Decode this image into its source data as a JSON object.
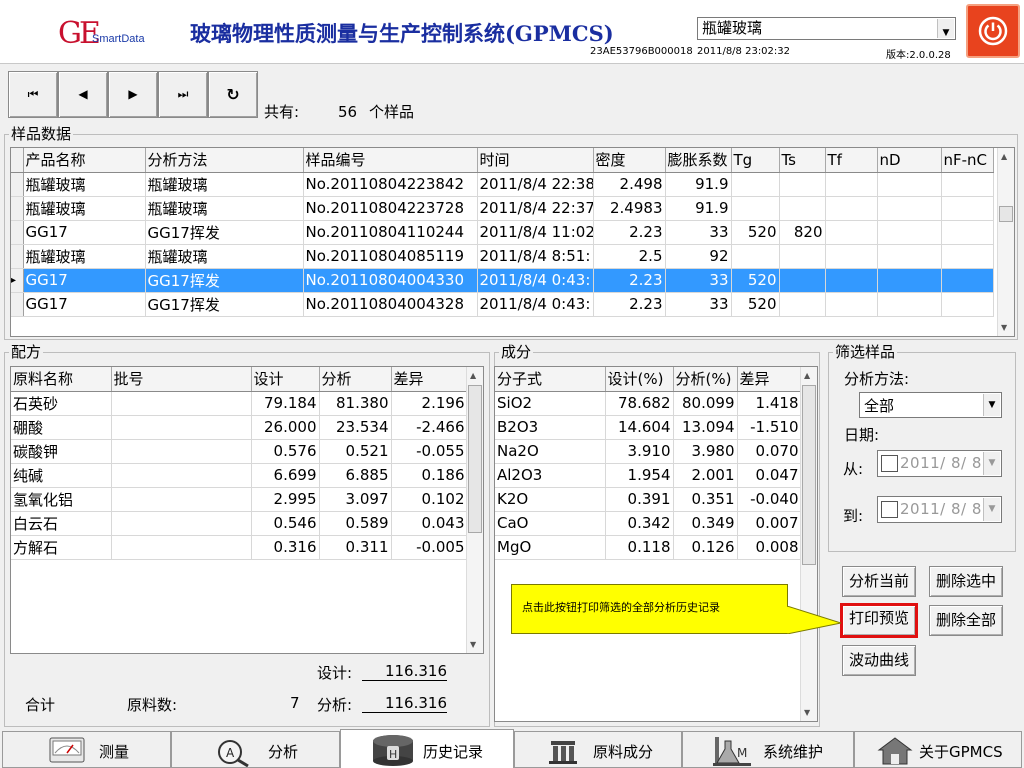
{
  "header": {
    "logo_main": "GE",
    "logo_sub": "SmartData",
    "title": "玻璃物理性质测量与生产控制系统(GPMCS)",
    "serial": "23AE53796B000018",
    "product_select": "瓶罐玻璃",
    "datetime": "2011/8/8 23:02:32",
    "version": "版本:2.0.0.28"
  },
  "nav": {
    "first": "⏮",
    "prev": "◀",
    "next": "▶",
    "last": "⏭",
    "refresh": "↻",
    "count_label": "共有:",
    "count_value": "56",
    "count_unit": "个样品"
  },
  "samples": {
    "title": "样品数据",
    "columns": [
      "产品名称",
      "分析方法",
      "样品编号",
      "时间",
      "密度",
      "膨胀系数",
      "Tg",
      "Ts",
      "Tf",
      "nD",
      "nF-nC"
    ],
    "rows": [
      [
        "瓶罐玻璃",
        "瓶罐玻璃",
        "No.20110804223842",
        "2011/8/4 22:38",
        "2.498",
        "91.9",
        "",
        "",
        "",
        "",
        ""
      ],
      [
        "瓶罐玻璃",
        "瓶罐玻璃",
        "No.20110804223728",
        "2011/8/4 22:37",
        "2.4983",
        "91.9",
        "",
        "",
        "",
        "",
        ""
      ],
      [
        "GG17",
        "GG17挥发",
        "No.20110804110244",
        "2011/8/4 11:02",
        "2.23",
        "33",
        "520",
        "820",
        "",
        "",
        ""
      ],
      [
        "瓶罐玻璃",
        "瓶罐玻璃",
        "No.20110804085119",
        "2011/8/4 8:51:",
        "2.5",
        "92",
        "",
        "",
        "",
        "",
        ""
      ],
      [
        "GG17",
        "GG17挥发",
        "No.20110804004330",
        "2011/8/4 0:43:",
        "2.23",
        "33",
        "520",
        "",
        "",
        "",
        ""
      ],
      [
        "GG17",
        "GG17挥发",
        "No.20110804004328",
        "2011/8/4 0:43:",
        "2.23",
        "33",
        "520",
        "",
        "",
        "",
        ""
      ]
    ],
    "selected_row": 4
  },
  "recipe": {
    "title": "配方",
    "columns": [
      "原料名称",
      "批号",
      "设计",
      "分析",
      "差异"
    ],
    "rows": [
      [
        "石英砂",
        "",
        "79.184",
        "81.380",
        "2.196"
      ],
      [
        "硼酸",
        "",
        "26.000",
        "23.534",
        "-2.466"
      ],
      [
        "碳酸钾",
        "",
        "0.576",
        "0.521",
        "-0.055"
      ],
      [
        "纯碱",
        "",
        "6.699",
        "6.885",
        "0.186"
      ],
      [
        "氢氧化铝",
        "",
        "2.995",
        "3.097",
        "0.102"
      ],
      [
        "白云石",
        "",
        "0.546",
        "0.589",
        "0.043"
      ],
      [
        "方解石",
        "",
        "0.316",
        "0.311",
        "-0.005"
      ]
    ],
    "design_label": "设计:",
    "design_value": "116.316",
    "total_label": "合计",
    "material_count_label": "原料数:",
    "material_count": "7",
    "analysis_label": "分析:",
    "analysis_value": "116.316"
  },
  "composition": {
    "title": "成分",
    "columns": [
      "分子式",
      "设计(%)",
      "分析(%)",
      "差异"
    ],
    "rows": [
      [
        "SiO2",
        "78.682",
        "80.099",
        "1.418"
      ],
      [
        "B2O3",
        "14.604",
        "13.094",
        "-1.510"
      ],
      [
        "Na2O",
        "3.910",
        "3.980",
        "0.070"
      ],
      [
        "Al2O3",
        "1.954",
        "2.001",
        "0.047"
      ],
      [
        "K2O",
        "0.391",
        "0.351",
        "-0.040"
      ],
      [
        "CaO",
        "0.342",
        "0.349",
        "0.007"
      ],
      [
        "MgO",
        "0.118",
        "0.126",
        "0.008"
      ]
    ]
  },
  "filter": {
    "title": "筛选样品",
    "method_label": "分析方法:",
    "method_value": "全部",
    "date_label": "日期:",
    "from_label": "从:",
    "from_value": "2011/  8/  8",
    "to_label": "到:",
    "to_value": "2011/  8/  8"
  },
  "actions": {
    "analyze_current": "分析当前",
    "delete_selected": "删除选中",
    "print_preview": "打印预览",
    "delete_all": "删除全部",
    "fluctuation_curve": "波动曲线"
  },
  "callout": "点击此按钮打印筛选的全部分析历史记录",
  "tabs": [
    {
      "label": "测量",
      "icon": "gauge-icon"
    },
    {
      "label": "分析",
      "icon": "magnifier-icon"
    },
    {
      "label": "历史记录",
      "icon": "database-icon"
    },
    {
      "label": "原料成分",
      "icon": "ingredient-icon"
    },
    {
      "label": "系统维护",
      "icon": "lab-flask-icon"
    },
    {
      "label": "关于GPMCS",
      "icon": "home-icon"
    }
  ],
  "active_tab": 2,
  "colors": {
    "title_blue": "#1a2ea0",
    "selection": "#3399ff",
    "power": "#e8431e",
    "callout": "#ffff00",
    "highlight_border": "#e01010"
  }
}
